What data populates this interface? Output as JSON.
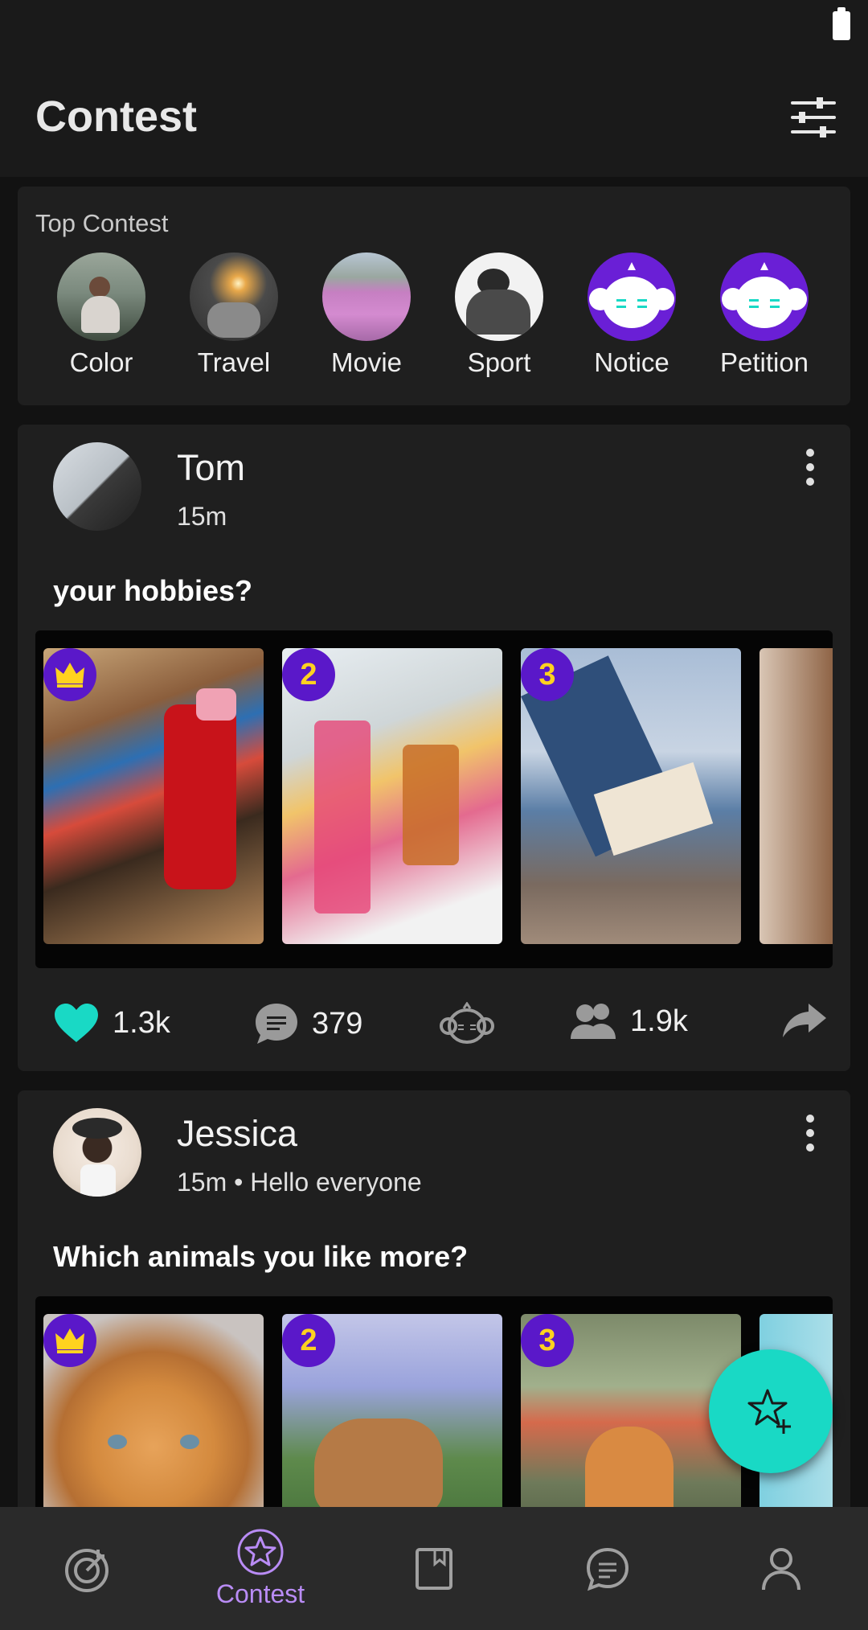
{
  "colors": {
    "background": "#121212",
    "card": "#1f1f1f",
    "accent_teal": "#19d9c5",
    "accent_purple": "#5a18c9",
    "nav_active": "#b98cf5"
  },
  "header": {
    "title": "Contest",
    "filter_icon": "sliders-icon"
  },
  "top_contest": {
    "label": "Top Contest",
    "items": [
      {
        "label": "Color"
      },
      {
        "label": "Travel"
      },
      {
        "label": "Movie"
      },
      {
        "label": "Sport"
      },
      {
        "label": "Notice"
      },
      {
        "label": "Petition"
      }
    ]
  },
  "posts": [
    {
      "author": "Tom",
      "meta": "15m",
      "question": "your hobbies?",
      "ranks": [
        "crown",
        "2",
        "3"
      ],
      "likes": "1.3k",
      "comments": "379",
      "participants": "1.9k"
    },
    {
      "author": "Jessica",
      "meta": "15m • Hello everyone",
      "question": "Which animals you like more?",
      "ranks": [
        "crown",
        "2",
        "3"
      ]
    }
  ],
  "nav": {
    "items": [
      {
        "icon": "target-icon"
      },
      {
        "icon": "star-icon",
        "label": "Contest",
        "active": true
      },
      {
        "icon": "bookmark-icon"
      },
      {
        "icon": "chat-icon"
      },
      {
        "icon": "profile-icon"
      }
    ]
  },
  "fab": {
    "icon": "star-plus-icon"
  }
}
